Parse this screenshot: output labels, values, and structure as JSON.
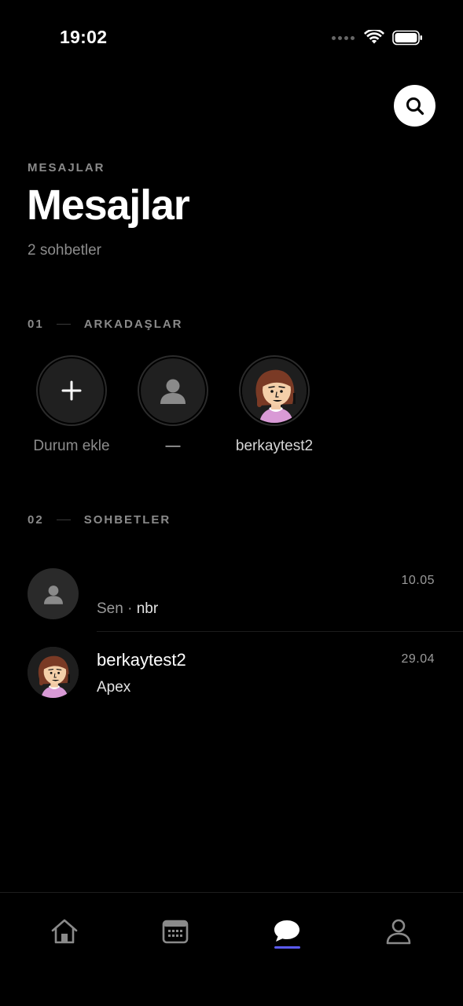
{
  "status_bar": {
    "time": "19:02"
  },
  "header": {
    "eyebrow": "MESAJLAR",
    "title": "Mesajlar",
    "subtitle": "2 sohbetler"
  },
  "friends_section": {
    "number": "01",
    "label": "ARKADAŞLAR",
    "items": [
      {
        "label": "Durum ekle",
        "icon": "plus-icon"
      },
      {
        "label": "—",
        "icon": "person-placeholder-icon"
      },
      {
        "label": "berkaytest2",
        "icon": "cartoon-avatar"
      }
    ]
  },
  "chats_section": {
    "number": "02",
    "label": "SOHBETLER",
    "chats": [
      {
        "name": "",
        "sender": "Sen",
        "separator": " · ",
        "message": "nbr",
        "time": "10.05",
        "avatar": "person-placeholder-icon"
      },
      {
        "name": "berkaytest2",
        "message": "Apex",
        "time": "29.04",
        "avatar": "cartoon-avatar"
      }
    ]
  },
  "tab_bar": {
    "tabs": [
      "home-icon",
      "calendar-icon",
      "chat-bubble-icon",
      "profile-icon"
    ],
    "active": "chat-bubble-icon",
    "accent": "#5b5bf5"
  }
}
